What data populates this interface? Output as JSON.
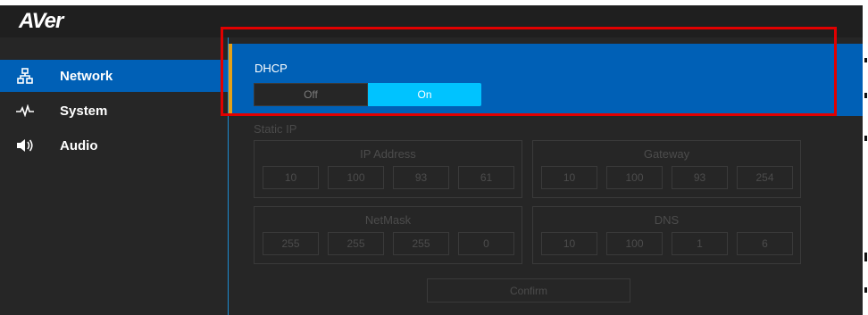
{
  "brand": {
    "logo_text": "AVer"
  },
  "sidebar": {
    "items": [
      {
        "label": "Network",
        "icon": "network-icon",
        "active": true
      },
      {
        "label": "System",
        "icon": "pulse-icon",
        "active": false
      },
      {
        "label": "Audio",
        "icon": "speaker-icon",
        "active": false
      }
    ]
  },
  "dhcp": {
    "label": "DHCP",
    "off_label": "Off",
    "on_label": "On",
    "value": "On"
  },
  "static_ip": {
    "label": "Static IP",
    "ip_address": {
      "title": "IP Address",
      "octets": [
        "10",
        "100",
        "93",
        "61"
      ]
    },
    "gateway": {
      "title": "Gateway",
      "octets": [
        "10",
        "100",
        "93",
        "254"
      ]
    },
    "netmask": {
      "title": "NetMask",
      "octets": [
        "255",
        "255",
        "255",
        "0"
      ]
    },
    "dns": {
      "title": "DNS",
      "octets": [
        "10",
        "100",
        "1",
        "6"
      ]
    },
    "confirm_label": "Confirm"
  },
  "colors": {
    "accent_blue": "#0060b6",
    "toggle_on": "#00c3ff",
    "highlight_red": "#e10000",
    "active_marker": "#e5a117"
  }
}
